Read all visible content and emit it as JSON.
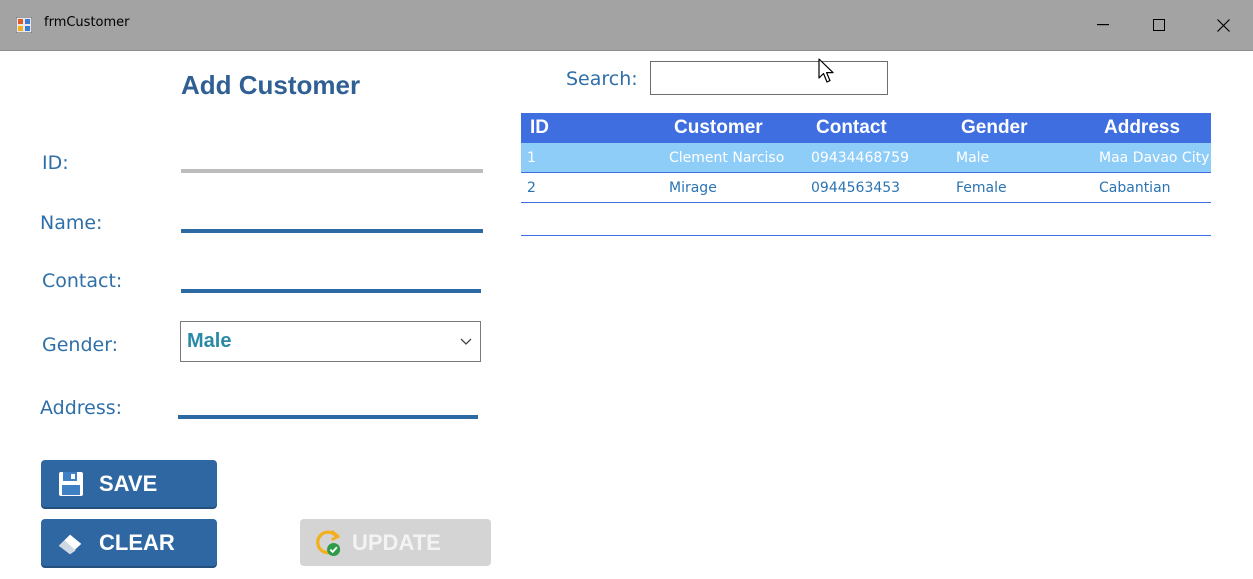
{
  "window": {
    "title": "frmCustomer"
  },
  "form": {
    "heading": "Add Customer",
    "id_label": "ID:",
    "name_label": "Name:",
    "contact_label": "Contact:",
    "gender_label": "Gender:",
    "gender_value": "Male",
    "address_label": "Address:"
  },
  "buttons": {
    "save": "SAVE",
    "clear": "CLEAR",
    "update": "UPDATE"
  },
  "search": {
    "label": "Search:",
    "value": ""
  },
  "table": {
    "columns": [
      "ID",
      "Customer",
      "Contact",
      "Gender",
      "Address"
    ],
    "rows": [
      {
        "id": "1",
        "customer": "Clement Narciso",
        "contact": "09434468759",
        "gender": "Male",
        "address": "Maa Davao City",
        "selected": true
      },
      {
        "id": "2",
        "customer": "Mirage",
        "contact": "0944563453",
        "gender": "Female",
        "address": "Cabantian",
        "selected": false
      }
    ]
  },
  "icons": {
    "app": "form-icon",
    "minimize": "minimize-icon",
    "maximize": "maximize-icon",
    "close": "close-icon",
    "save": "floppy-disk-icon",
    "clear": "eraser-icon",
    "update": "refresh-check-icon",
    "dropdown": "chevron-down-icon"
  },
  "colors": {
    "accent": "#2f67a3",
    "header": "#3f6ee0",
    "selected_row": "#8fcdf9",
    "label": "#2f6fa8"
  }
}
